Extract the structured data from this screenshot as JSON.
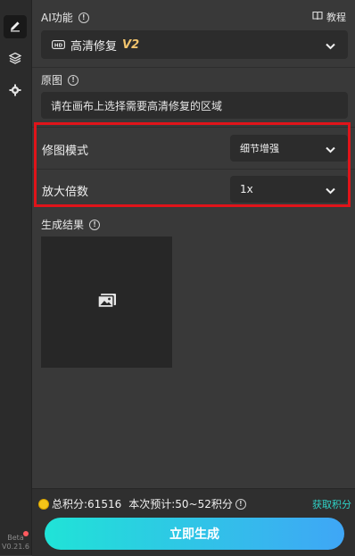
{
  "sidebar": {
    "items": [
      {
        "icon": "edit-icon",
        "active": true
      },
      {
        "icon": "layers-icon",
        "active": false
      },
      {
        "icon": "gear-icon",
        "active": false
      }
    ],
    "beta_label": "Beta",
    "version": "V0.21.6"
  },
  "ai_function": {
    "label": "AI功能",
    "tutorial_label": "教程",
    "selected_name": "高清修复",
    "selected_version": "V2",
    "badge_icon": "hd-icon"
  },
  "original": {
    "label": "原图",
    "placeholder": "请在画布上选择需要高清修复的区域"
  },
  "mode": {
    "label": "修图模式",
    "value": "细节增强"
  },
  "scale": {
    "label": "放大倍数",
    "value": "1x"
  },
  "result": {
    "label": "生成结果",
    "empty_icon": "image-placeholder-icon"
  },
  "footer": {
    "total_points_text": "总积分:61516",
    "estimate_text": "本次预计:50~52积分",
    "get_points_label": "获取积分",
    "generate_label": "立即生成"
  },
  "colors": {
    "accent": "#2fd3c7",
    "highlight": "#e0141a",
    "version_text": "#f2c46d"
  }
}
